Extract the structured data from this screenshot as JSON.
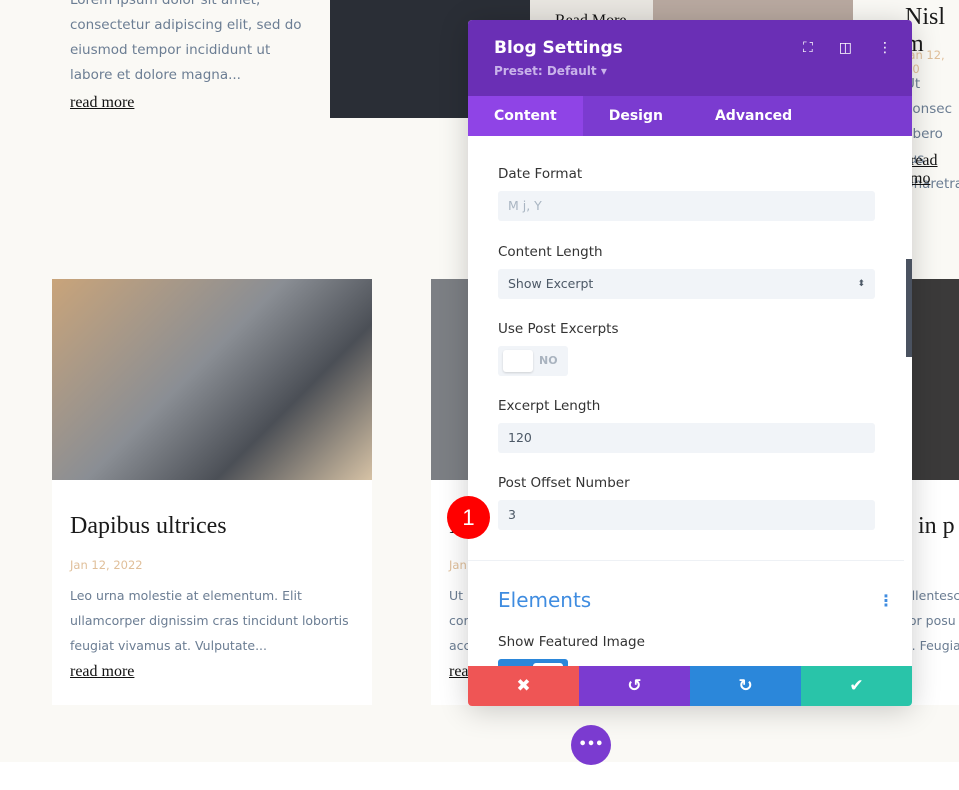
{
  "background_posts": {
    "top_left": {
      "excerpt_lines": [
        "Lorem ipsum dolor sit amet,",
        "consectetur adipiscing elit, sed do",
        "eiusmod tempor incididunt ut",
        "labore et dolore magna..."
      ],
      "read_more": "read more"
    },
    "top_middle": {
      "read_more": "Read More"
    },
    "top_right": {
      "title": "Nisl m",
      "date": "Jan 12, 20",
      "excerpt_lines": [
        "Ut consec",
        "libero jus",
        "pharetra"
      ],
      "read_more": "read mo"
    },
    "bottom_left": {
      "title": "Dapibus ultrices",
      "date": "Jan 12, 2022",
      "excerpt_lines": [
        "Leo urna molestie at elementum. Elit",
        "ullamcorper dignissim cras tincidunt lobortis",
        "feugiat vivamus at. Vulputate..."
      ],
      "read_more": "read more"
    },
    "bottom_middle": {
      "title": "I",
      "date": "Jan",
      "excerpt_lines": [
        "Ut",
        "cor",
        "acc"
      ],
      "read_more": "rea"
    },
    "bottom_right": {
      "title": "d in p",
      "excerpt_lines": [
        "ellentesc",
        "tor posu",
        "a. Feugia"
      ]
    }
  },
  "panel": {
    "title": "Blog Settings",
    "preset": "Preset: Default ▾",
    "header_icons": [
      "fullscreen-icon",
      "sidebar-layout-icon",
      "more-vertical-icon"
    ],
    "tabs": [
      {
        "label": "Content",
        "active": true
      },
      {
        "label": "Design"
      },
      {
        "label": "Advanced"
      }
    ],
    "fields": {
      "date_format": {
        "label": "Date Format",
        "placeholder": "M j, Y"
      },
      "content_length": {
        "label": "Content Length",
        "value": "Show Excerpt"
      },
      "use_post_excerpts": {
        "label": "Use Post Excerpts",
        "value": "NO"
      },
      "excerpt_length": {
        "label": "Excerpt Length",
        "value": "120"
      },
      "post_offset": {
        "label": "Post Offset Number",
        "value": "3"
      }
    },
    "elements_section": {
      "title": "Elements",
      "show_featured_image_label": "Show Featured Image"
    },
    "footer": {
      "cancel": "✖",
      "undo": "↺",
      "redo": "↻",
      "save": "✔"
    },
    "colors": {
      "header": "#6a2fb5",
      "tabs": "#7b3bd0",
      "cancel": "#ef5555",
      "undo": "#7b3bd0",
      "redo": "#2b87da",
      "save": "#29c4a9"
    }
  },
  "annotation": {
    "step_marker": "1"
  },
  "fab": {
    "label": "•••"
  }
}
